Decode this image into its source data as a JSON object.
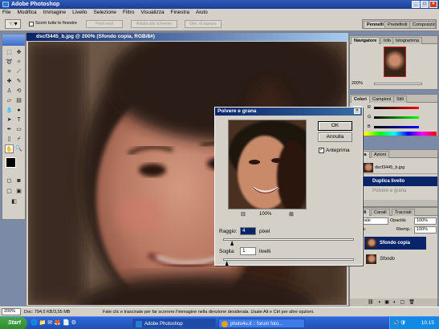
{
  "window": {
    "title": "Adobe Photoshop"
  },
  "menu": [
    "File",
    "Modifica",
    "Immagine",
    "Livello",
    "Selezione",
    "Filtro",
    "Visualizza",
    "Finestra",
    "Aiuto"
  ],
  "options": {
    "scroll_all": "Scorri tutte le finestre",
    "btn_actual": "Pixel reali",
    "btn_fit": "Adatta allo schermo",
    "btn_print": "Dim. di stampa"
  },
  "topright": {
    "tab1": "Pennelli",
    "tab2": "Predefiniti",
    "tab3": "Composizioni livelli"
  },
  "document": {
    "title": "dscf3445_b.jpg @ 200% (Sfondo copia, RGB/8#)"
  },
  "navigator": {
    "tabs": [
      "Navigatore",
      "Info",
      "Istogramma"
    ],
    "zoom": "200%"
  },
  "colors": {
    "tabs": [
      "Colori",
      "Campioni",
      "Stili"
    ],
    "channels": [
      "R",
      "G",
      "B"
    ]
  },
  "history": {
    "tabs": [
      "Storia",
      "Azioni"
    ],
    "snapshot": "dscf3445_b.jpg",
    "items": [
      "Duplica livello",
      "Polvere e grana"
    ]
  },
  "layers": {
    "tabs": [
      "Livelli",
      "Canali",
      "Tracciati"
    ],
    "blend": "Normale",
    "opacity_label": "Opacità:",
    "opacity": "100%",
    "lock_label": "Blocca:",
    "fill_label": "Riemp.:",
    "fill": "100%",
    "items": [
      "Sfondo copia",
      "Sfondo"
    ]
  },
  "dialog": {
    "title": "Polvere e grana",
    "ok": "OK",
    "cancel": "Annulla",
    "preview": "Anteprima",
    "zoom": "100%",
    "zoom_minus": "⊟",
    "zoom_plus": "⊞",
    "radius_label": "Raggio:",
    "radius_value": "4",
    "radius_unit": "pixel",
    "radius_fraction": 0.05,
    "threshold_label": "Soglia:",
    "threshold_value": "1",
    "threshold_unit": "livelli",
    "threshold_fraction": 0.01
  },
  "status": {
    "zoom": "200%",
    "doc": "Doc: 794,5 KB/3,55 MB",
    "hint": "Fate clic e trascinate per far scorrere l'immagine nella direzione desiderata. Usate Alt e Ctrl per altre opzioni."
  },
  "taskbar": {
    "start": "Start",
    "tasks": [
      "Adobe Photoshop",
      "photo4u.it :: forum foto..."
    ],
    "clock": "10.15"
  },
  "accent": "#0a246a"
}
